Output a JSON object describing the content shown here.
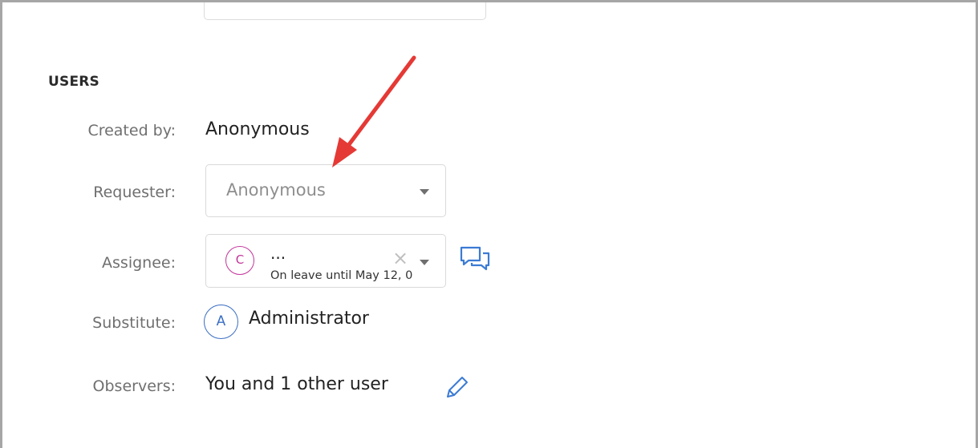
{
  "section": {
    "title": "USERS"
  },
  "created_by": {
    "label": "Created by:",
    "value": "Anonymous"
  },
  "requester": {
    "label": "Requester:",
    "value": "Anonymous"
  },
  "assignee": {
    "label": "Assignee:",
    "avatar_initial": "C",
    "name": "...",
    "status": "On leave until May 12, 0",
    "clear_symbol": "×",
    "chat_icon": "chat-bubbles-icon"
  },
  "substitute": {
    "label": "Substitute:",
    "avatar_initial": "A",
    "value": "Administrator"
  },
  "observers": {
    "label": "Observers:",
    "value": "You and 1 other user",
    "edit_icon": "pencil-icon"
  },
  "colors": {
    "annotation_arrow": "#e53935",
    "assignee_avatar": "#c2359a",
    "substitute_avatar": "#3b6fc3",
    "icon_blue": "#3b7bd4"
  }
}
